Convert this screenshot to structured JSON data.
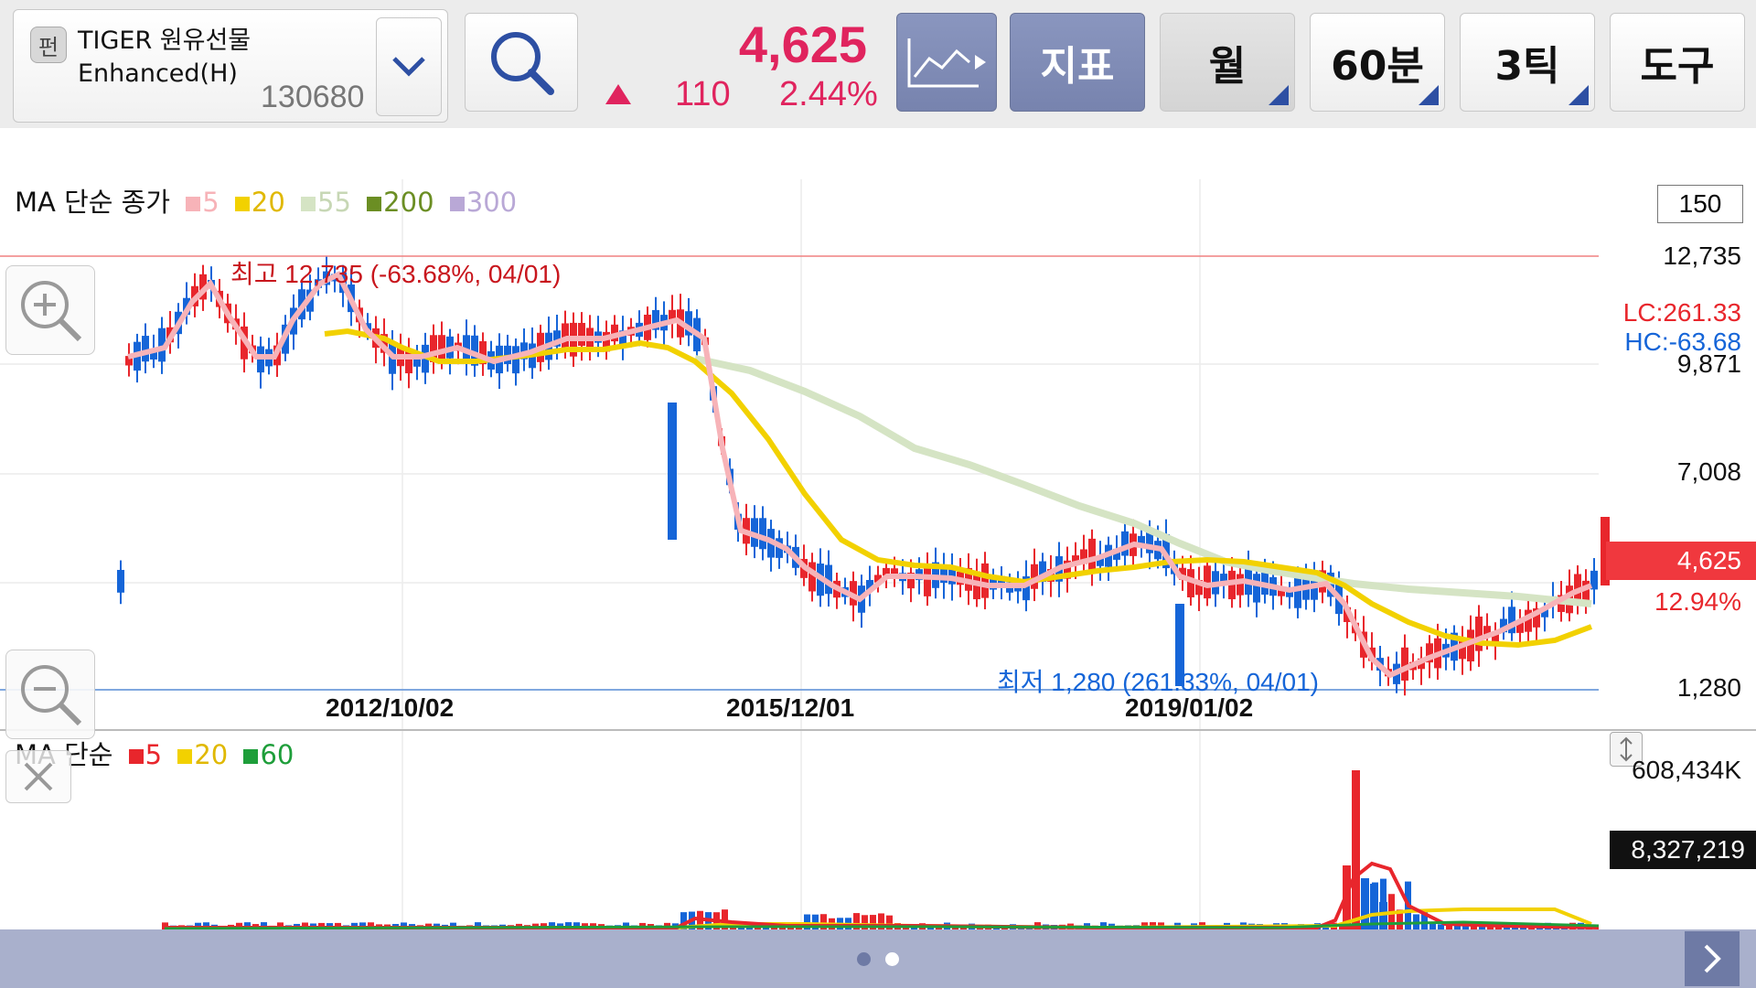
{
  "stock": {
    "badge": "펀",
    "name": "TIGER 원유선물Enhanced(H)",
    "code": "130680",
    "price": "4,625",
    "change": "110",
    "change_pct": "2.44%"
  },
  "toolbar": {
    "indicator_label": "지표",
    "month_label": "월",
    "min60_label": "60분",
    "tick3_label": "3틱",
    "tools_label": "도구"
  },
  "main_chart": {
    "legend_prefix": "MA 단순 종가",
    "ma": [
      {
        "label": "5",
        "color": "#f7b3b8"
      },
      {
        "label": "20",
        "color": "#f2d100"
      },
      {
        "label": "55",
        "color": "#d5e4c4"
      },
      {
        "label": "200",
        "color": "#6b8e23"
      },
      {
        "label": "300",
        "color": "#b9a8d6"
      }
    ],
    "count_box": "150",
    "y_labels": [
      "12,735",
      "9,871",
      "7,008",
      "1,280"
    ],
    "lc_label": "LC:261.33",
    "hc_label": "HC:-63.68",
    "current_price_tag": "4,625",
    "current_pct": "12.94%",
    "high_annotation": "최고 12,735 (-63.68%, 04/01)",
    "low_annotation": "최저 1,280 (261.33%, 04/01)",
    "x_labels": [
      "2012/10/02",
      "2015/12/01",
      "2019/01/02"
    ],
    "colors": {
      "up": "#e8262c",
      "down": "#1565d8",
      "high_line": "#f08080",
      "low_line": "#5a8ed8"
    }
  },
  "volume_chart": {
    "legend_prefix": "MA 단순",
    "ma": [
      {
        "label": "5",
        "color": "#e8262c"
      },
      {
        "label": "20",
        "color": "#f2d100"
      },
      {
        "label": "60",
        "color": "#1e9e3a"
      }
    ],
    "y_max_label": "608,434K",
    "current_volume": "8,327,219"
  },
  "icons": {
    "search": "search-icon",
    "dropdown": "chevron-down-icon",
    "chart_type": "line-chart-icon",
    "zoom_in": "zoom-in-icon",
    "zoom_out": "zoom-out-icon",
    "close": "close-icon",
    "resize": "vertical-resize-icon",
    "next": "chevron-right-icon"
  }
}
